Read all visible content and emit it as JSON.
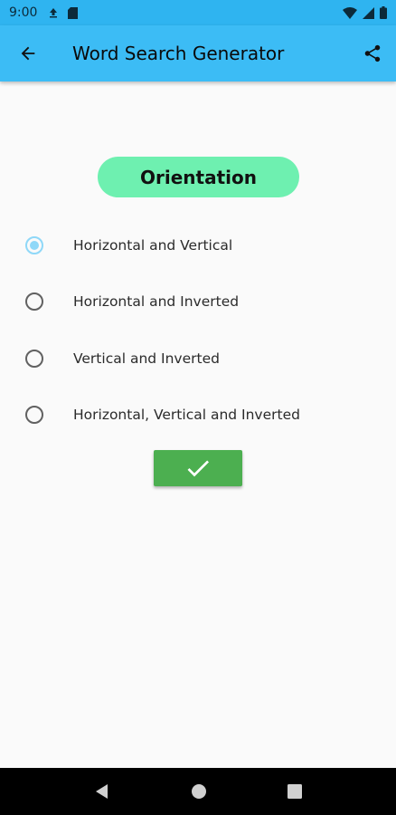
{
  "status_bar": {
    "time": "9:00",
    "icons": [
      "upload-icon",
      "sd-card-icon",
      "wifi-icon",
      "signal-icon",
      "battery-icon"
    ]
  },
  "app_bar": {
    "title": "Word Search Generator",
    "back_icon": "back-arrow-icon",
    "share_icon": "share-icon",
    "color": "#3cbcf5"
  },
  "section": {
    "heading": "Orientation",
    "heading_bg": "#6ef0b0"
  },
  "options": [
    {
      "label": "Horizontal and Vertical",
      "selected": true
    },
    {
      "label": "Horizontal and Inverted",
      "selected": false
    },
    {
      "label": "Vertical and Inverted",
      "selected": false
    },
    {
      "label": "Horizontal, Vertical and Inverted",
      "selected": false
    }
  ],
  "confirm": {
    "icon": "checkmark-icon",
    "color": "#4caf50"
  },
  "nav_bar": {
    "icons": [
      "nav-back-icon",
      "nav-home-icon",
      "nav-recents-icon"
    ]
  }
}
